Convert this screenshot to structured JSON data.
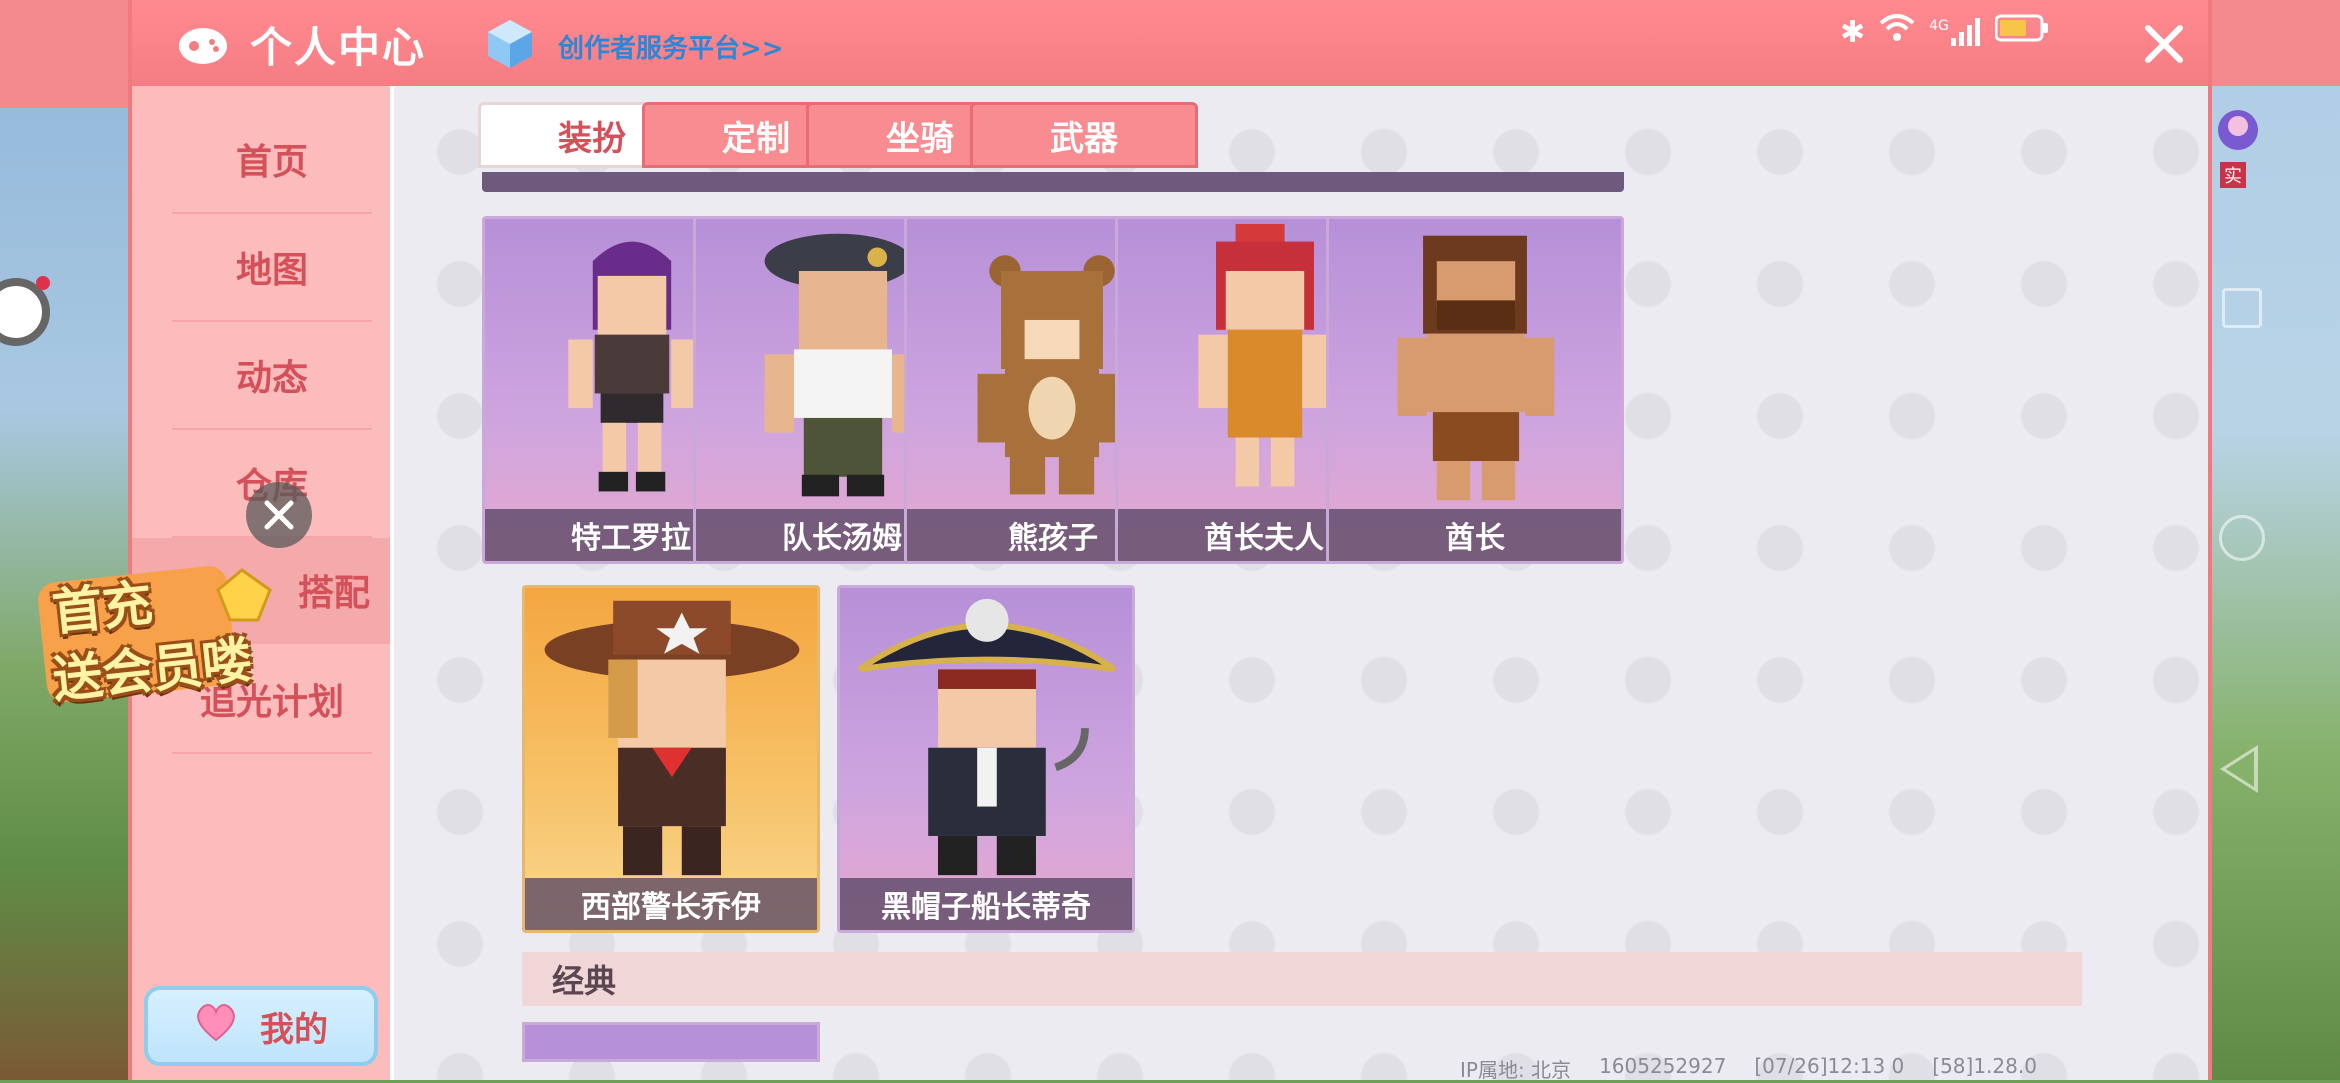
{
  "header": {
    "title": "个人中心",
    "creator_link": "创作者服务平台>>",
    "status": {
      "network": "4G"
    }
  },
  "sidebar": {
    "items": [
      {
        "label": "首页"
      },
      {
        "label": "地图"
      },
      {
        "label": "动态"
      },
      {
        "label": "仓库"
      },
      {
        "label": "搭配"
      },
      {
        "label": "追光计划"
      }
    ],
    "my_button": "我的"
  },
  "tabs": [
    {
      "label": "装扮",
      "active": true
    },
    {
      "label": "定制",
      "active": false
    },
    {
      "label": "坐骑",
      "active": false
    },
    {
      "label": "武器",
      "active": false
    }
  ],
  "skins_row1": [
    {
      "name": "特工罗拉"
    },
    {
      "name": "队长汤姆"
    },
    {
      "name": "熊孩子"
    },
    {
      "name": "酋长夫人"
    },
    {
      "name": "酋长"
    }
  ],
  "skins_row2": [
    {
      "name": "西部警长乔伊"
    },
    {
      "name": "黑帽子船长蒂奇"
    }
  ],
  "section": {
    "classic_title": "经典"
  },
  "footer": {
    "ip_location": "IP属地: 北京",
    "uid": "1605252927",
    "time": "[07/26]12:13 0",
    "version": "[58]1.28.0"
  },
  "promo": {
    "line1": "首充",
    "line2": "送会员喽"
  },
  "right_badge": "实",
  "colors": {
    "header": "#f47d83",
    "sidebar": "#fcbcbc",
    "accent_text": "#d4515a",
    "tab_inactive": "#f98c90",
    "card_purple": "#b690d8",
    "card_gold": "#f4a640",
    "link": "#2e86d6"
  }
}
